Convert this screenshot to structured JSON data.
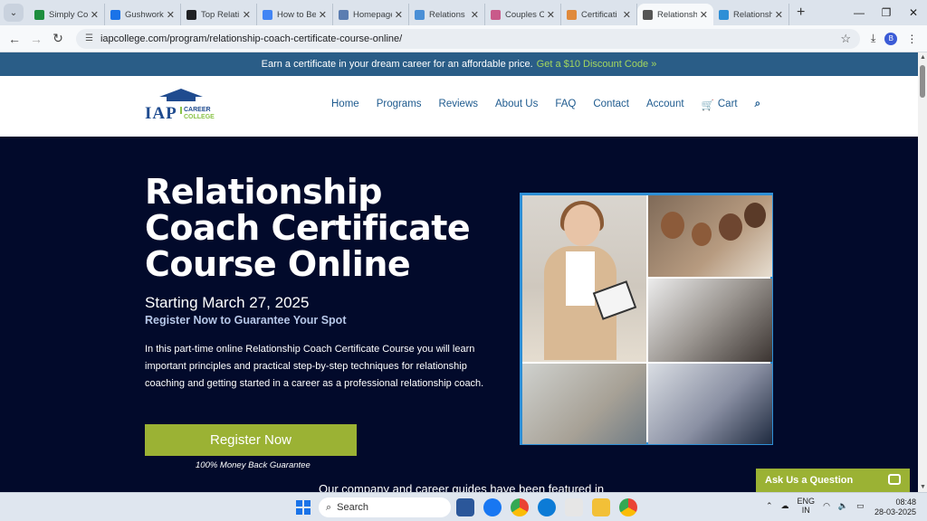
{
  "browser": {
    "tabs": [
      {
        "title": "Simply Co",
        "color": "#1e8e3e"
      },
      {
        "title": "Gushwork",
        "color": "#1a73e8"
      },
      {
        "title": "Top Relati",
        "color": "#202124"
      },
      {
        "title": "How to Be",
        "color": "#4285f4"
      },
      {
        "title": "Homepage",
        "color": "#5b7db1"
      },
      {
        "title": "Relations",
        "color": "#4a8fd6"
      },
      {
        "title": "Couples C",
        "color": "#c95a8a"
      },
      {
        "title": "Certificati",
        "color": "#e08a3c"
      },
      {
        "title": "Relationsh",
        "color": "#555555",
        "active": true
      },
      {
        "title": "Relationsh",
        "color": "#2e8fd6"
      }
    ],
    "url": "iapcollege.com/program/relationship-coach-certificate-course-online/",
    "profile_initial": "B"
  },
  "promo": {
    "text": "Earn a certificate in your dream career for an affordable price.",
    "link": "Get a $10 Discount Code »"
  },
  "logo": {
    "text": "IAP",
    "line1": "CAREER",
    "line2": "COLLEGE"
  },
  "nav": [
    "Home",
    "Programs",
    "Reviews",
    "About Us",
    "FAQ",
    "Contact",
    "Account",
    "Cart"
  ],
  "hero": {
    "title": "Relationship Coach Certificate Course Online",
    "starting": "Starting March 27, 2025",
    "register_tagline": "Register Now to Guarantee Your Spot",
    "description": "In this part-time online Relationship Coach Certificate Course you will learn important principles and practical step-by-step techniques for relationship coaching and getting started in a career as a professional relationship coach.",
    "cta": "Register Now",
    "guarantee": "100% Money Back Guarantee",
    "featured": "Our company and career guides have been featured in"
  },
  "ask_widget": "Ask Us a Question",
  "taskbar": {
    "search_placeholder": "Search",
    "lang_top": "ENG",
    "lang_bottom": "IN",
    "time": "08:48",
    "date": "28-03-2025"
  },
  "colors": {
    "accent": "#9bb234",
    "promo_bar": "#2a5d87",
    "hero_bg": "#020a2b",
    "nav_link": "#1f5b8f"
  }
}
